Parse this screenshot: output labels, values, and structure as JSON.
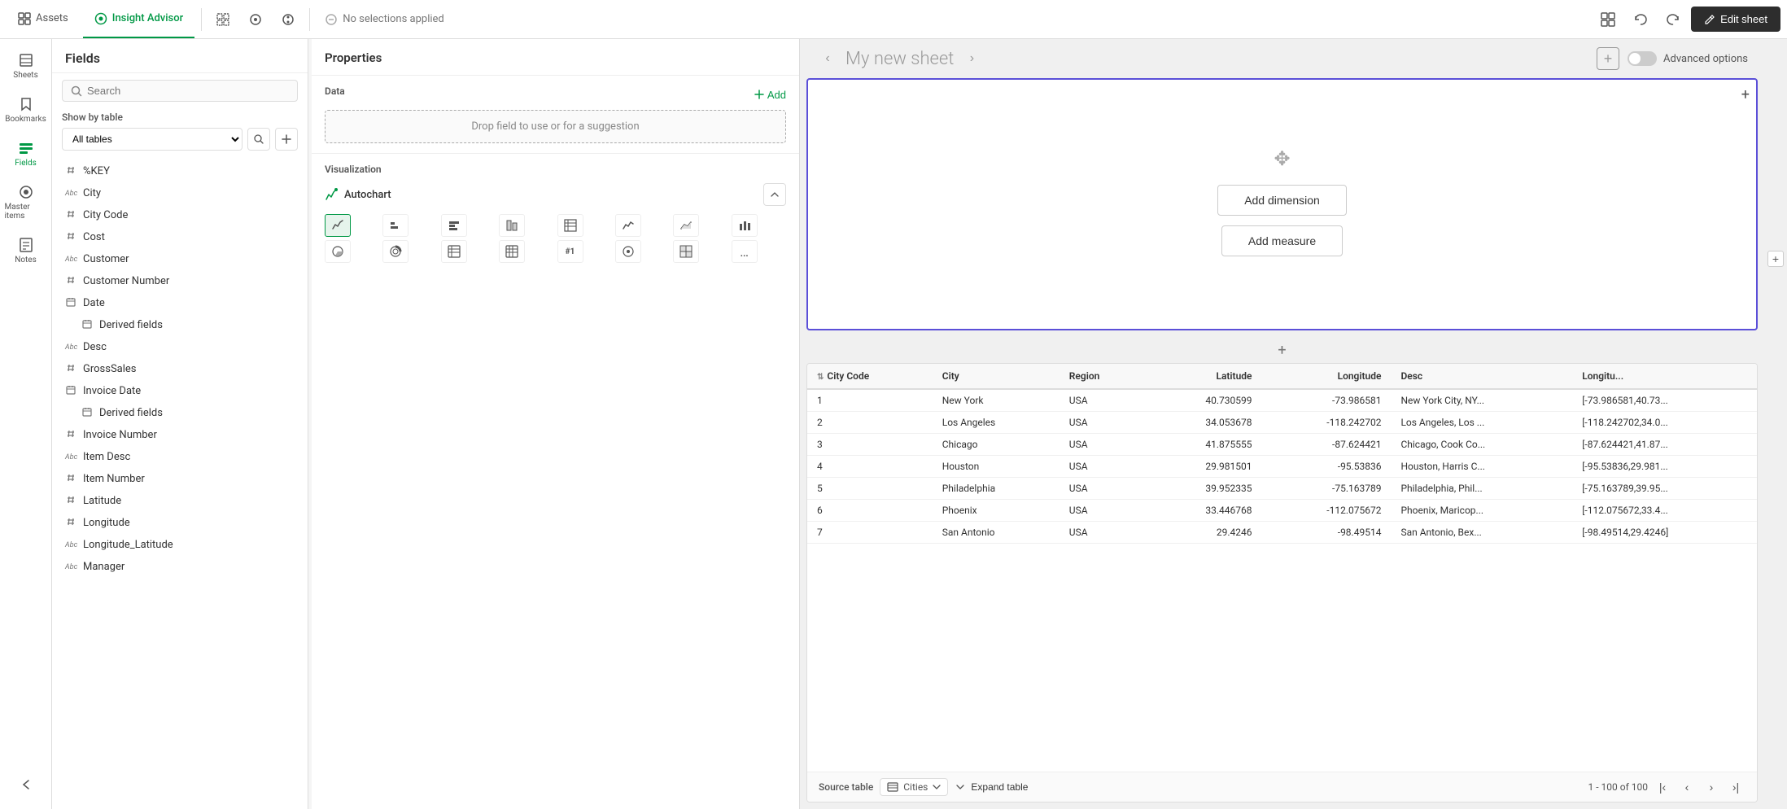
{
  "topbar": {
    "assets_tab": "Assets",
    "insight_tab": "Insight Advisor",
    "no_selections": "No selections applied",
    "edit_sheet": "Edit sheet"
  },
  "left_nav": {
    "items": [
      {
        "id": "sheets",
        "label": "Sheets",
        "icon": "sheets"
      },
      {
        "id": "bookmarks",
        "label": "Bookmarks",
        "icon": "bookmarks"
      },
      {
        "id": "fields",
        "label": "Fields",
        "icon": "fields",
        "active": true
      },
      {
        "id": "master-items",
        "label": "Master items",
        "icon": "master-items"
      },
      {
        "id": "notes",
        "label": "Notes",
        "icon": "notes"
      }
    ]
  },
  "fields_panel": {
    "title": "Fields",
    "search_placeholder": "Search",
    "show_by_table_label": "Show by table",
    "table_options": [
      "All tables"
    ],
    "selected_table": "All tables",
    "fields": [
      {
        "type": "#",
        "name": "%KEY",
        "indent": 0
      },
      {
        "type": "Abc",
        "name": "City",
        "indent": 0
      },
      {
        "type": "#",
        "name": "City Code",
        "indent": 0
      },
      {
        "type": "#",
        "name": "Cost",
        "indent": 0
      },
      {
        "type": "Abc",
        "name": "Customer",
        "indent": 0
      },
      {
        "type": "#",
        "name": "Customer Number",
        "indent": 0
      },
      {
        "type": "cal",
        "name": "Date",
        "indent": 0
      },
      {
        "type": "cal",
        "name": "Derived fields",
        "indent": 1
      },
      {
        "type": "Abc",
        "name": "Desc",
        "indent": 0
      },
      {
        "type": "#",
        "name": "GrossSales",
        "indent": 0
      },
      {
        "type": "cal",
        "name": "Invoice Date",
        "indent": 0
      },
      {
        "type": "cal",
        "name": "Derived fields",
        "indent": 1
      },
      {
        "type": "#",
        "name": "Invoice Number",
        "indent": 0
      },
      {
        "type": "Abc",
        "name": "Item Desc",
        "indent": 0
      },
      {
        "type": "#",
        "name": "Item Number",
        "indent": 0
      },
      {
        "type": "#",
        "name": "Latitude",
        "indent": 0
      },
      {
        "type": "#",
        "name": "Longitude",
        "indent": 0
      },
      {
        "type": "Abc",
        "name": "Longitude_Latitude",
        "indent": 0
      },
      {
        "type": "Abc",
        "name": "Manager",
        "indent": 0
      }
    ]
  },
  "properties_panel": {
    "title": "Properties",
    "data_label": "Data",
    "add_label": "+ Add",
    "drop_hint": "Drop field to use or for a suggestion",
    "viz_label": "Visualization",
    "autochart_label": "Autochart",
    "viz_types": [
      {
        "id": "autochart",
        "icon": "✦",
        "label": "Autochart",
        "active": true
      },
      {
        "id": "bar-h",
        "icon": "▥",
        "label": "Horizontal bar"
      },
      {
        "id": "bar-stacked",
        "icon": "▦",
        "label": "Stacked bar"
      },
      {
        "id": "bar-v",
        "icon": "▤",
        "label": "Vertical bar"
      },
      {
        "id": "combo",
        "icon": "⊞",
        "label": "Combo"
      },
      {
        "id": "line",
        "icon": "📈",
        "label": "Line"
      },
      {
        "id": "area",
        "icon": "📉",
        "label": "Area"
      },
      {
        "id": "bar2",
        "icon": "📊",
        "label": "Bar"
      },
      {
        "id": "pie-donut",
        "icon": "◑",
        "label": "Pie/Donut"
      },
      {
        "id": "pie",
        "icon": "◔",
        "label": "Pie"
      },
      {
        "id": "table",
        "icon": "⊟",
        "label": "Table"
      },
      {
        "id": "pivot",
        "icon": "⊞",
        "label": "Pivot"
      },
      {
        "id": "kpi",
        "icon": "#1",
        "label": "KPI"
      },
      {
        "id": "map",
        "icon": "🌐",
        "label": "Map"
      },
      {
        "id": "treemap",
        "icon": "▦",
        "label": "Treemap"
      },
      {
        "id": "more",
        "icon": "…",
        "label": "More"
      }
    ]
  },
  "sheet": {
    "title": "My new sheet",
    "add_dimension": "Add dimension",
    "add_measure": "Add measure",
    "advanced_options": "Advanced options",
    "add_plus": "+",
    "add_between": "+"
  },
  "table": {
    "columns": [
      {
        "id": "city_code",
        "label": "City Code",
        "type": "sort-num"
      },
      {
        "id": "city",
        "label": "City",
        "type": "text"
      },
      {
        "id": "region",
        "label": "Region",
        "type": "text"
      },
      {
        "id": "latitude",
        "label": "Latitude",
        "type": "num"
      },
      {
        "id": "longitude",
        "label": "Longitude",
        "type": "num"
      },
      {
        "id": "desc",
        "label": "Desc",
        "type": "text"
      },
      {
        "id": "longitu",
        "label": "Longitu...",
        "type": "text"
      }
    ],
    "rows": [
      {
        "city_code": "1",
        "city": "New York",
        "region": "USA",
        "latitude": "40.730599",
        "longitude": "-73.986581",
        "desc": "New York City, NY...",
        "longitu": "[-73.986581,40.73..."
      },
      {
        "city_code": "2",
        "city": "Los Angeles",
        "region": "USA",
        "latitude": "34.053678",
        "longitude": "-118.242702",
        "desc": "Los Angeles, Los ...",
        "longitu": "[-118.242702,34.0..."
      },
      {
        "city_code": "3",
        "city": "Chicago",
        "region": "USA",
        "latitude": "41.875555",
        "longitude": "-87.624421",
        "desc": "Chicago, Cook Co...",
        "longitu": "[-87.624421,41.87..."
      },
      {
        "city_code": "4",
        "city": "Houston",
        "region": "USA",
        "latitude": "29.981501",
        "longitude": "-95.53836",
        "desc": "Houston, Harris C...",
        "longitu": "[-95.53836,29.981..."
      },
      {
        "city_code": "5",
        "city": "Philadelphia",
        "region": "USA",
        "latitude": "39.952335",
        "longitude": "-75.163789",
        "desc": "Philadelphia, Phil...",
        "longitu": "[-75.163789,39.95..."
      },
      {
        "city_code": "6",
        "city": "Phoenix",
        "region": "USA",
        "latitude": "33.446768",
        "longitude": "-112.075672",
        "desc": "Phoenix, Maricop...",
        "longitu": "[-112.075672,33.4..."
      },
      {
        "city_code": "7",
        "city": "San Antonio",
        "region": "USA",
        "latitude": "29.4246",
        "longitude": "-98.49514",
        "desc": "San Antonio, Bex...",
        "longitu": "[-98.49514,29.4246]"
      }
    ],
    "source_table": "Cities",
    "expand_label": "Expand table",
    "page_info": "1 - 100 of 100"
  }
}
